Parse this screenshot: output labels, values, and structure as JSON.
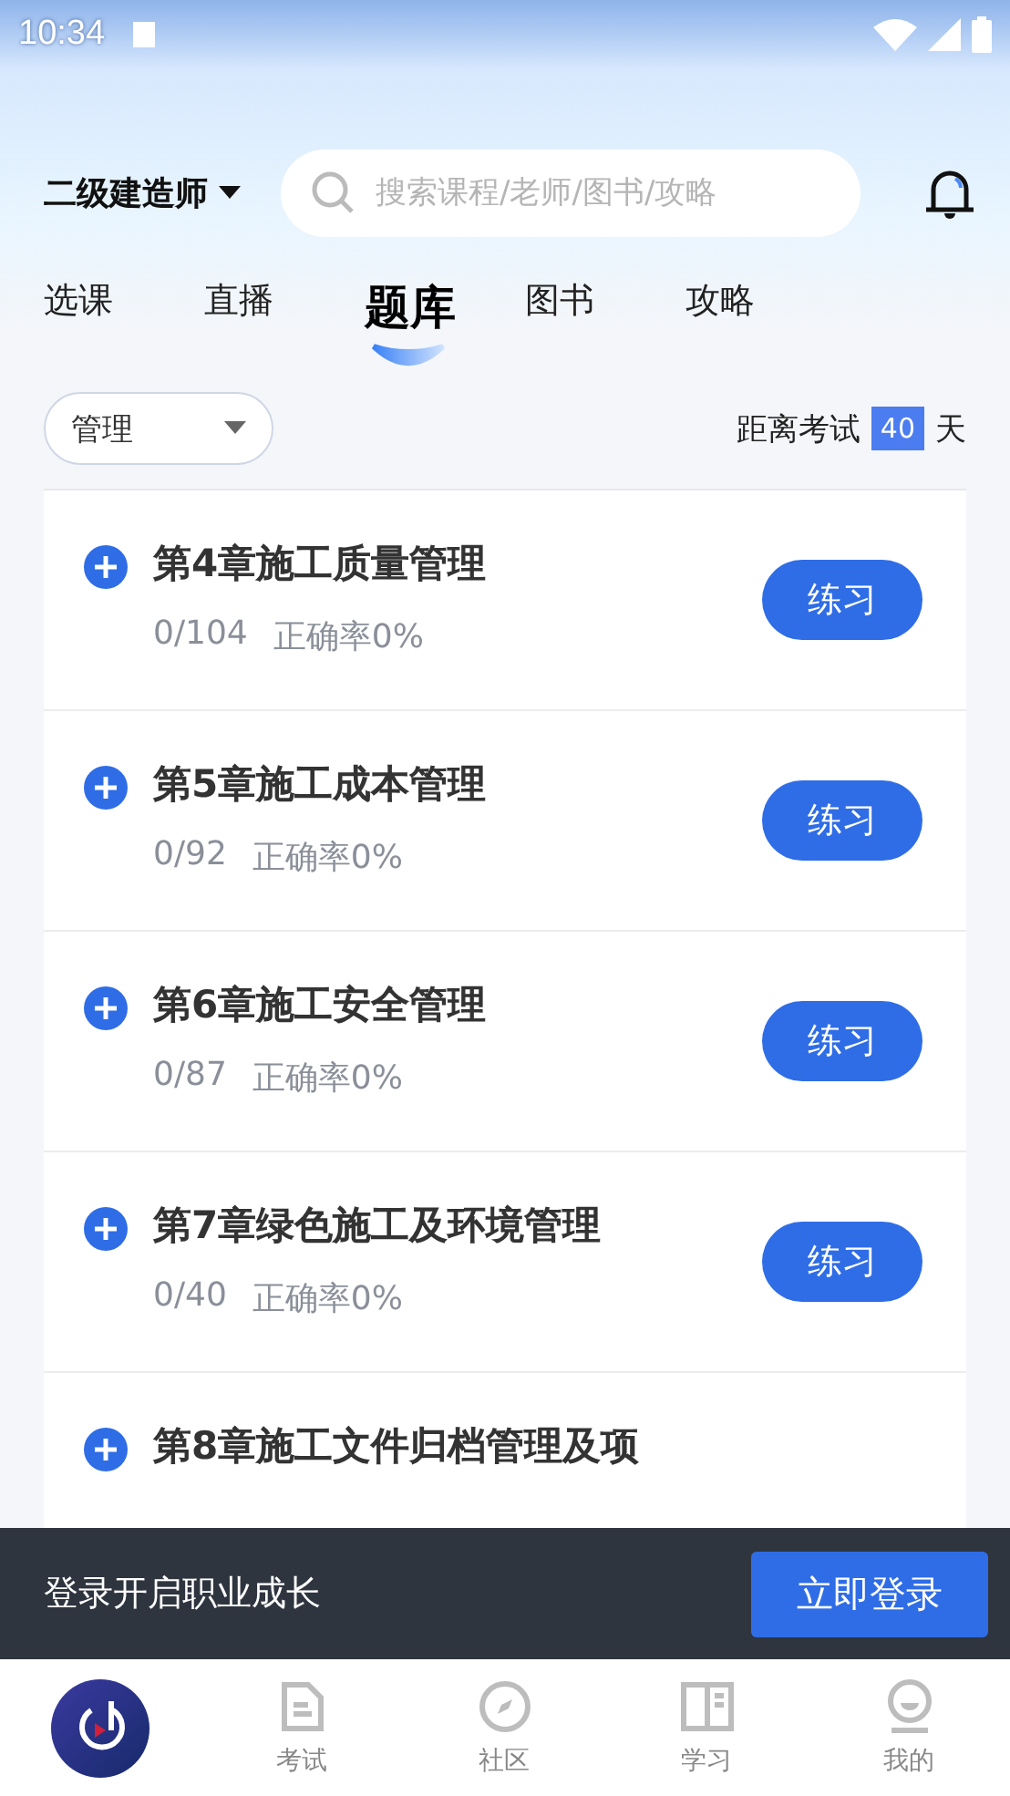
{
  "status_bar": {
    "time": "10:34"
  },
  "header": {
    "exam": "二级建造师",
    "search": {
      "placeholder": "搜索课程/老师/图书/攻略"
    }
  },
  "tabs": [
    {
      "label": "选课",
      "selected": false
    },
    {
      "label": "直播",
      "selected": false
    },
    {
      "label": "题库",
      "selected": true
    },
    {
      "label": "图书",
      "selected": false
    },
    {
      "label": "攻略",
      "selected": false
    }
  ],
  "filter": {
    "value": "管理"
  },
  "countdown": {
    "prefix": "距离考试",
    "days": "40",
    "suffix": "天"
  },
  "chapters": [
    {
      "title": "第4章施工质量管理",
      "progress": "0/104",
      "accuracy": "正确率0%",
      "action": "练习"
    },
    {
      "title": "第5章施工成本管理",
      "progress": "0/92",
      "accuracy": "正确率0%",
      "action": "练习"
    },
    {
      "title": "第6章施工安全管理",
      "progress": "0/87",
      "accuracy": "正确率0%",
      "action": "练习"
    },
    {
      "title": "第7章绿色施工及环境管理",
      "progress": "0/40",
      "accuracy": "正确率0%",
      "action": "练习"
    },
    {
      "title": "第8章施工文件归档管理及项"
    }
  ],
  "login_banner": {
    "text": "登录开启职业成长",
    "button": "立即登录"
  },
  "bottom_nav": [
    {
      "label": "考试"
    },
    {
      "label": "社区"
    },
    {
      "label": "学习"
    },
    {
      "label": "我的"
    }
  ]
}
